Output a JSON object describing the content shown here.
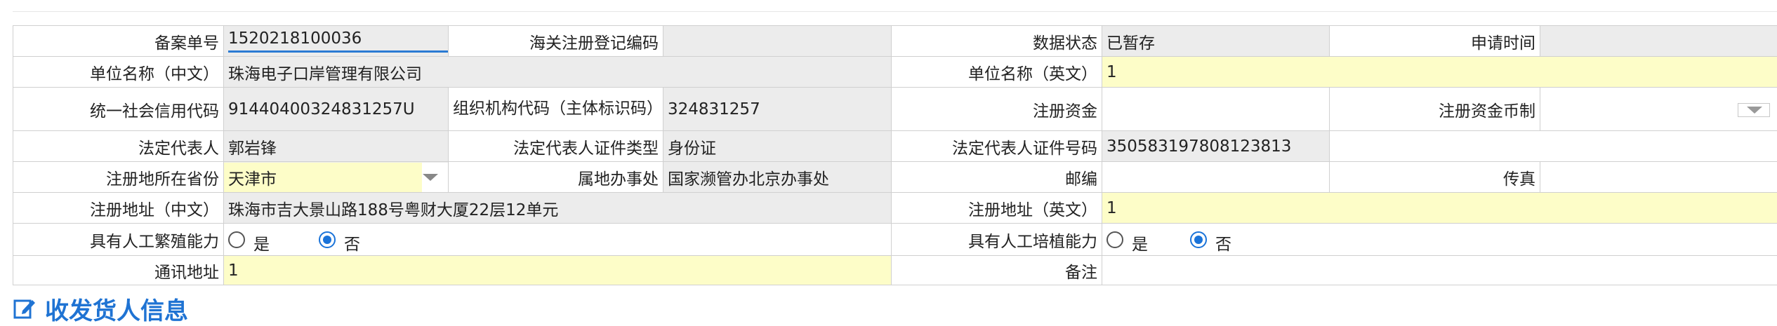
{
  "form": {
    "record_no_label": "备案单号",
    "record_no_value": "1520218100036",
    "customs_code_label": "海关注册登记编码",
    "customs_code_value": "",
    "data_status_label": "数据状态",
    "data_status_value": "已暂存",
    "apply_time_label": "申请时间",
    "apply_time_value": "",
    "unit_name_cn_label": "单位名称（中文）",
    "unit_name_cn_value": "珠海电子口岸管理有限公司",
    "unit_name_en_label": "单位名称（英文）",
    "unit_name_en_value": "1",
    "credit_code_label": "统一社会信用代码",
    "credit_code_value": "91440400324831257U",
    "org_code_label": "组织机构代码（主体标识码）",
    "org_code_value": "324831257",
    "reg_capital_label": "注册资金",
    "reg_capital_value": "",
    "reg_currency_label": "注册资金币制",
    "reg_currency_value": "",
    "legal_rep_label": "法定代表人",
    "legal_rep_value": "郭岩锋",
    "legal_id_type_label": "法定代表人证件类型",
    "legal_id_type_value": "身份证",
    "legal_id_no_label": "法定代表人证件号码",
    "legal_id_no_value": "350583197808123813",
    "province_label": "注册地所在省份",
    "province_value": "天津市",
    "office_label": "属地办事处",
    "office_value": "国家濒管办北京办事处",
    "postcode_label": "邮编",
    "postcode_value": "",
    "fax_label": "传真",
    "fax_value": "",
    "addr_cn_label": "注册地址（中文）",
    "addr_cn_value": "珠海市吉大景山路188号粤财大厦22层12单元",
    "addr_en_label": "注册地址（英文）",
    "addr_en_value": "1",
    "breeding_label": "具有人工繁殖能力",
    "breeding_yes": "是",
    "breeding_no": "否",
    "breeding_selected": "否",
    "cultivation_label": "具有人工培植能力",
    "cultivation_yes": "是",
    "cultivation_no": "否",
    "cultivation_selected": "否",
    "contact_addr_label": "通讯地址",
    "contact_addr_value": "1",
    "remark_label": "备注",
    "remark_value": ""
  },
  "section": {
    "title": "收发货人信息",
    "icon": "edit-icon"
  },
  "colors": {
    "readonly_bg": "#ececec",
    "required_bg": "#fdfdc8",
    "accent": "#1f73d3"
  }
}
